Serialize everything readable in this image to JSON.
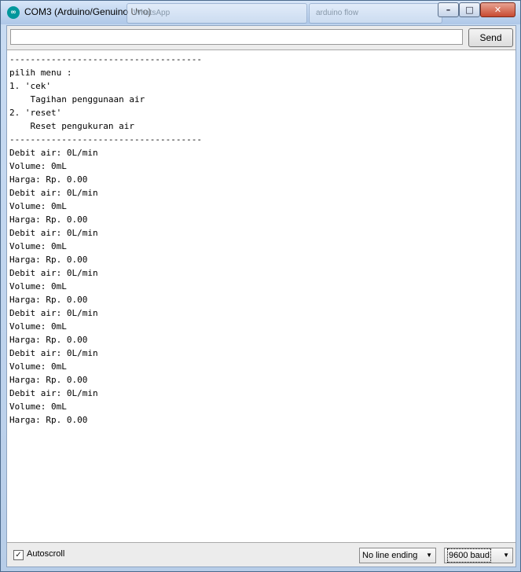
{
  "window": {
    "title": "COM3 (Arduino/Genuino Uno)",
    "icon": "arduino-logo",
    "background_windows": [
      "WhatsApp",
      "arduino flow"
    ],
    "controls": {
      "minimize": "–",
      "maximize": "□",
      "close": "✕"
    }
  },
  "toolbar": {
    "input_value": "",
    "send_label": "Send"
  },
  "console": {
    "lines": [
      "-------------------------------------",
      "pilih menu :",
      "1. 'cek'",
      "    Tagihan penggunaan air",
      "2. 'reset'",
      "    Reset pengukuran air",
      "-------------------------------------",
      "Debit air: 0L/min",
      "Volume: 0mL",
      "Harga: Rp. 0.00",
      "Debit air: 0L/min",
      "Volume: 0mL",
      "Harga: Rp. 0.00",
      "Debit air: 0L/min",
      "Volume: 0mL",
      "Harga: Rp. 0.00",
      "Debit air: 0L/min",
      "Volume: 0mL",
      "Harga: Rp. 0.00",
      "Debit air: 0L/min",
      "Volume: 0mL",
      "Harga: Rp. 0.00",
      "Debit air: 0L/min",
      "Volume: 0mL",
      "Harga: Rp. 0.00",
      "Debit air: 0L/min",
      "Volume: 0mL",
      "Harga: Rp. 0.00"
    ]
  },
  "footer": {
    "autoscroll_label": "Autoscroll",
    "autoscroll_checked": true,
    "line_ending": "No line ending",
    "baud_rate": "9600 baud"
  },
  "colors": {
    "accent": "#00979c"
  }
}
